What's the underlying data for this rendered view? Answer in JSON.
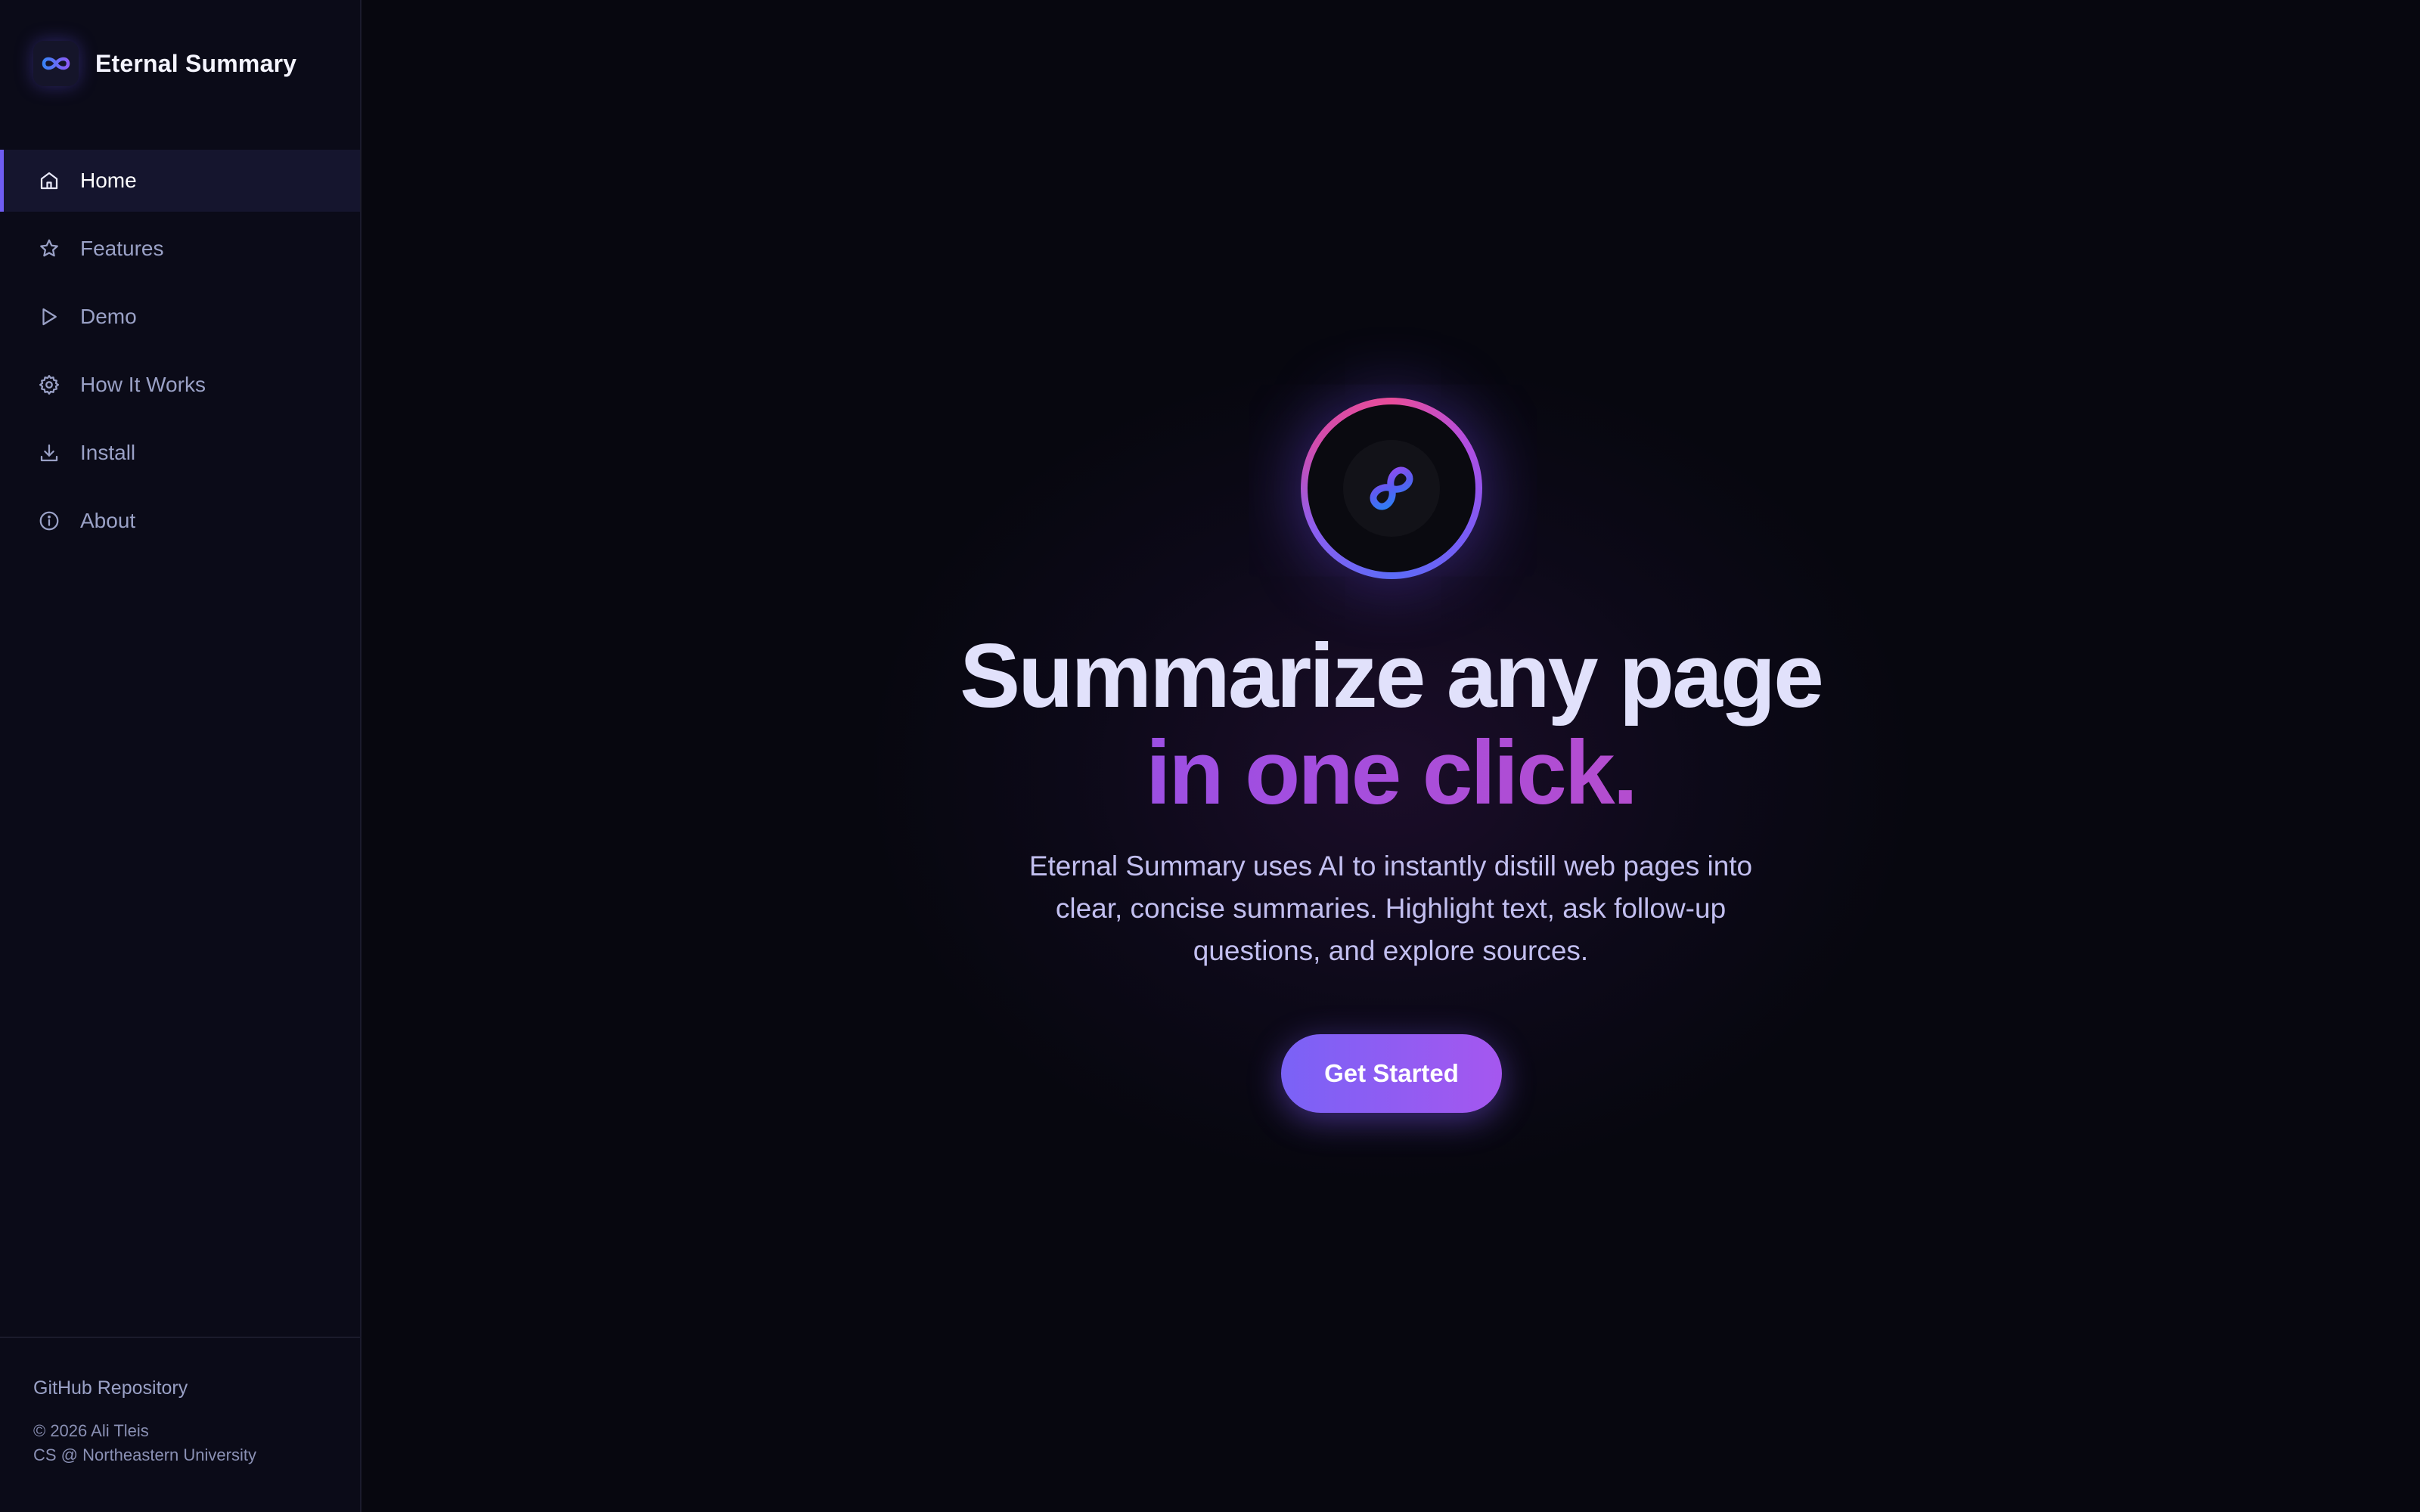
{
  "brand": {
    "name": "Eternal Summary",
    "logo_icon": "infinity-icon"
  },
  "sidebar": {
    "items": [
      {
        "label": "Home",
        "icon": "home-icon",
        "active": true
      },
      {
        "label": "Features",
        "icon": "star-icon",
        "active": false
      },
      {
        "label": "Demo",
        "icon": "play-icon",
        "active": false
      },
      {
        "label": "How It Works",
        "icon": "gear-icon",
        "active": false
      },
      {
        "label": "Install",
        "icon": "download-icon",
        "active": false
      },
      {
        "label": "About",
        "icon": "info-icon",
        "active": false
      }
    ],
    "footer": {
      "repo_link": "GitHub Repository",
      "copyright_line1": "© 2026 Ali Tleis",
      "copyright_line2": "CS @ Northeastern University"
    }
  },
  "hero": {
    "logo_icon": "infinity-icon",
    "headline_line1": "Summarize any page",
    "headline_line2": "in one click.",
    "description": "Eternal Summary uses AI to instantly distill web pages into clear, concise summaries. Highlight text, ask follow-up questions, and explore sources.",
    "cta_label": "Get Started"
  },
  "colors": {
    "background": "#07070f",
    "sidebar_background": "#0b0b18",
    "accent": "#6f5cf2",
    "gradient_start": "#7b57f0",
    "gradient_end": "#df4aa8",
    "cta_start": "#7a62f6",
    "cta_end": "#a557ef",
    "headline_text": "#e1e1fb",
    "muted_text": "#9aa1c6"
  }
}
